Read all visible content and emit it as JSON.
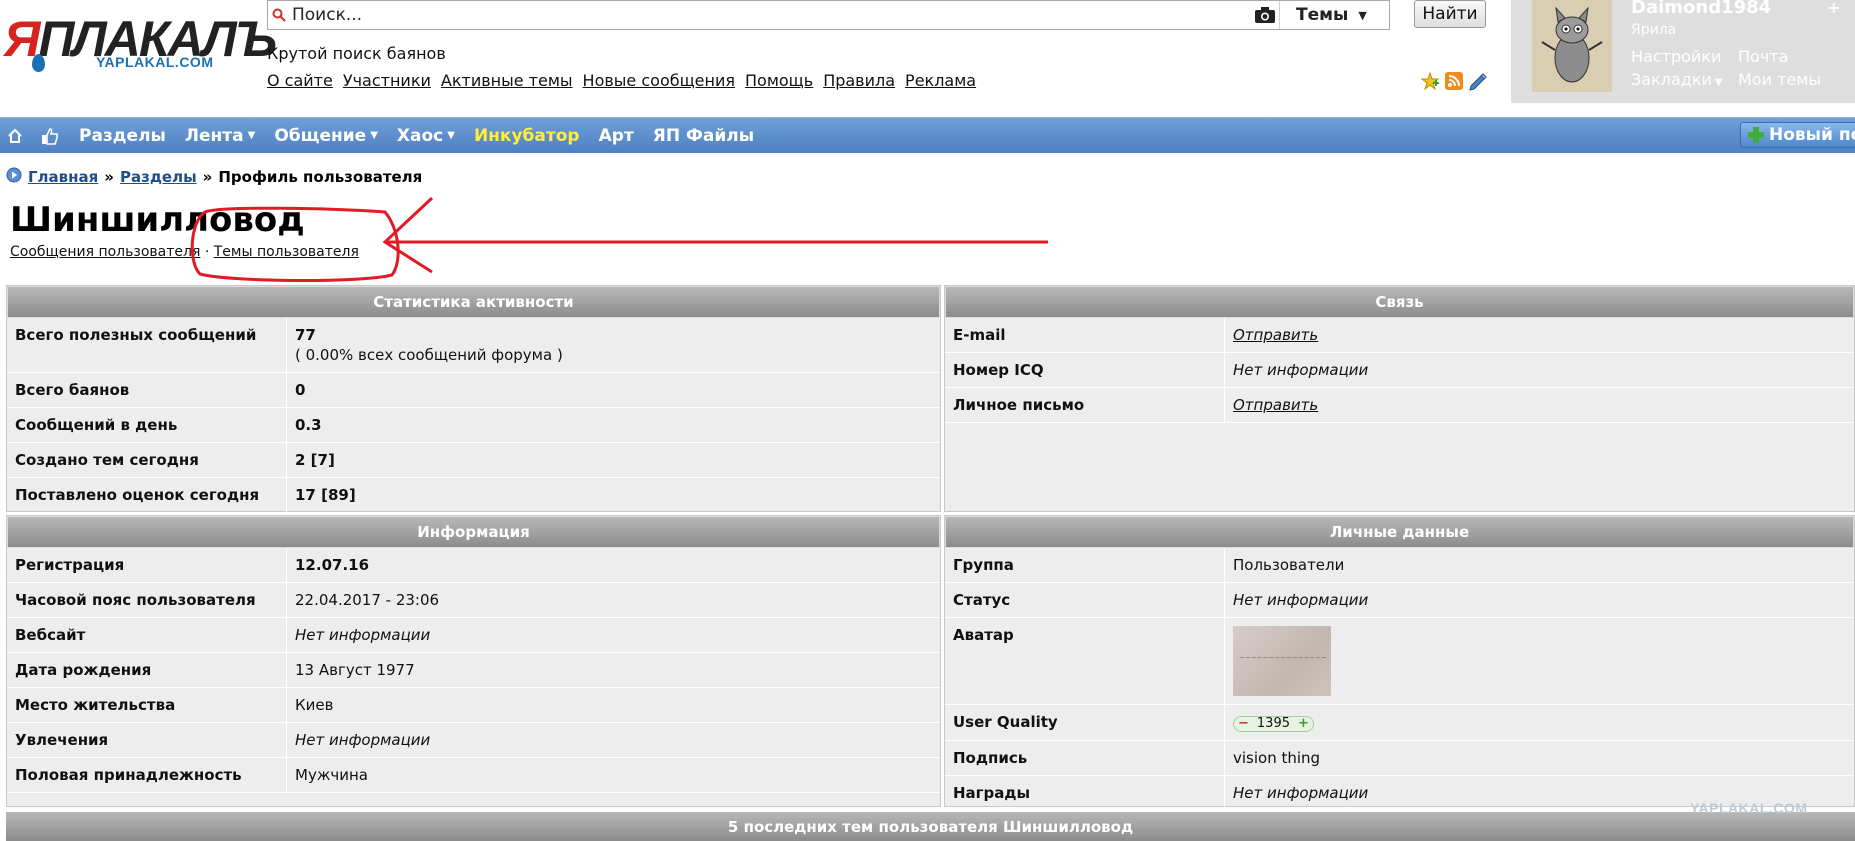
{
  "header": {
    "logo_text_ya": "Я",
    "logo_text_rest": "ПЛАКАЛЪ",
    "logo_sub": "YAPLAKAL.COM",
    "search_placeholder": "Поиск...",
    "search_scope": "Темы",
    "search_button": "Найти",
    "search_sub": "Крутой поиск баянов",
    "top_links": [
      "О сайте",
      "Участники",
      "Активные темы",
      "Новые сообщения",
      "Помощь",
      "Правила",
      "Реклама"
    ]
  },
  "user": {
    "name": "Daimond1984",
    "rank": "Ярила",
    "settings": "Настройки",
    "mail": "Почта",
    "bookmarks": "Закладки",
    "my_topics": "Мои темы"
  },
  "nav": {
    "items": [
      "Разделы",
      "Лента",
      "Общение",
      "Хаос",
      "Инкубатор",
      "Арт",
      "ЯП Файлы"
    ],
    "new_post": "Новый по"
  },
  "breadcrumb": {
    "home": "Главная",
    "sep": "»",
    "sections": "Разделы",
    "current": "Профиль пользователя"
  },
  "profile": {
    "title": "Шиншилловод",
    "messages_link": "Сообщения пользователя",
    "dot": "·",
    "topics_link": "Темы пользователя"
  },
  "stats": {
    "header": "Статистика активности",
    "rows": [
      {
        "label": "Всего полезных сообщений",
        "value": "77",
        "note": "( 0.00% всех сообщений форума )"
      },
      {
        "label": "Всего баянов",
        "value": "0"
      },
      {
        "label": "Сообщений в день",
        "value": "0.3"
      },
      {
        "label": "Создано тем сегодня",
        "value": "2 [7]"
      },
      {
        "label": "Поставлено оценок сегодня",
        "value": "17 [89]"
      }
    ]
  },
  "contact": {
    "header": "Связь",
    "rows": [
      {
        "label": "E-mail",
        "value": "Отправить"
      },
      {
        "label": "Номер ICQ",
        "value": "Нет информации"
      },
      {
        "label": "Личное письмо",
        "value": "Отправить"
      }
    ]
  },
  "info": {
    "header": "Информация",
    "rows": [
      {
        "label": "Регистрация",
        "value": "12.07.16"
      },
      {
        "label": "Часовой пояс пользователя",
        "value": "22.04.2017 - 23:06"
      },
      {
        "label": "Вебсайт",
        "value": "Нет информации"
      },
      {
        "label": "Дата рождения",
        "value": "13 Август 1977"
      },
      {
        "label": "Место жительства",
        "value": "Киев"
      },
      {
        "label": "Увлечения",
        "value": "Нет информации"
      },
      {
        "label": "Половая принадлежность",
        "value": "Мужчина"
      }
    ]
  },
  "personal": {
    "header": "Личные данные",
    "rows": [
      {
        "label": "Группа",
        "value": "Пользователи"
      },
      {
        "label": "Статус",
        "value": "Нет информации"
      },
      {
        "label": "Аватар",
        "value": ""
      },
      {
        "label": "User Quality",
        "value": "1395"
      },
      {
        "label": "Подпись",
        "value": "vision thing"
      },
      {
        "label": "Награды",
        "value": "Нет информации"
      }
    ],
    "uq_minus": "−",
    "uq_plus": "+"
  },
  "bottom": {
    "header": "5 последних тем пользователя Шиншилловод",
    "watermark": "YAPLAKAL.COM"
  },
  "colors": {
    "nav_blue": "#5a8bcb",
    "annotation_red": "#e01b24",
    "incubator_yellow": "#ffef3a"
  }
}
